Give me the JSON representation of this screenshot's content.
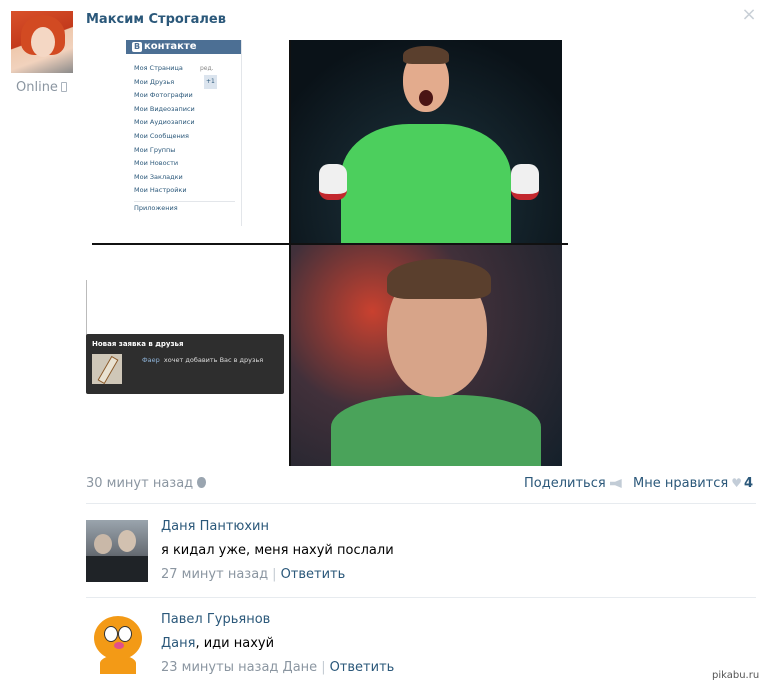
{
  "post": {
    "author": "Максим Строгалев",
    "online_status": "Online",
    "time": "30 минут назад",
    "share_label": "Поделиться",
    "like_label": "Мне нравится",
    "like_count": "4"
  },
  "vk_screenshot": {
    "logo": "контакте",
    "logo_letter": "В",
    "edit": "ред.",
    "badge": "+1",
    "menu": [
      "Моя Страница",
      "Мои Друзья",
      "Мои Фотографии",
      "Мои Видеозаписи",
      "Мои Аудиозаписи",
      "Мои Сообщения",
      "Мои Группы",
      "Мои Новости",
      "Мои Закладки",
      "Мои Настройки"
    ],
    "apps": "Приложения"
  },
  "notification": {
    "title": "Новая заявка в друзья",
    "sender": "Фаер",
    "text": "хочет добавить Вас в друзья"
  },
  "comments": [
    {
      "name": "Даня Пантюхин",
      "text": "я кидал уже, меня нахуй послали",
      "time": "27 минут назад",
      "reply": "Ответить"
    },
    {
      "name": "Павел Гурьянов",
      "mention": "Даня",
      "text": ", иди нахуй",
      "time": "23 минуты назад Дане",
      "reply": "Ответить"
    }
  ],
  "watermark": "pikabu.ru",
  "colors": {
    "link": "#2b587a",
    "muted": "#8b96a1",
    "divider": "#e7ebef"
  }
}
